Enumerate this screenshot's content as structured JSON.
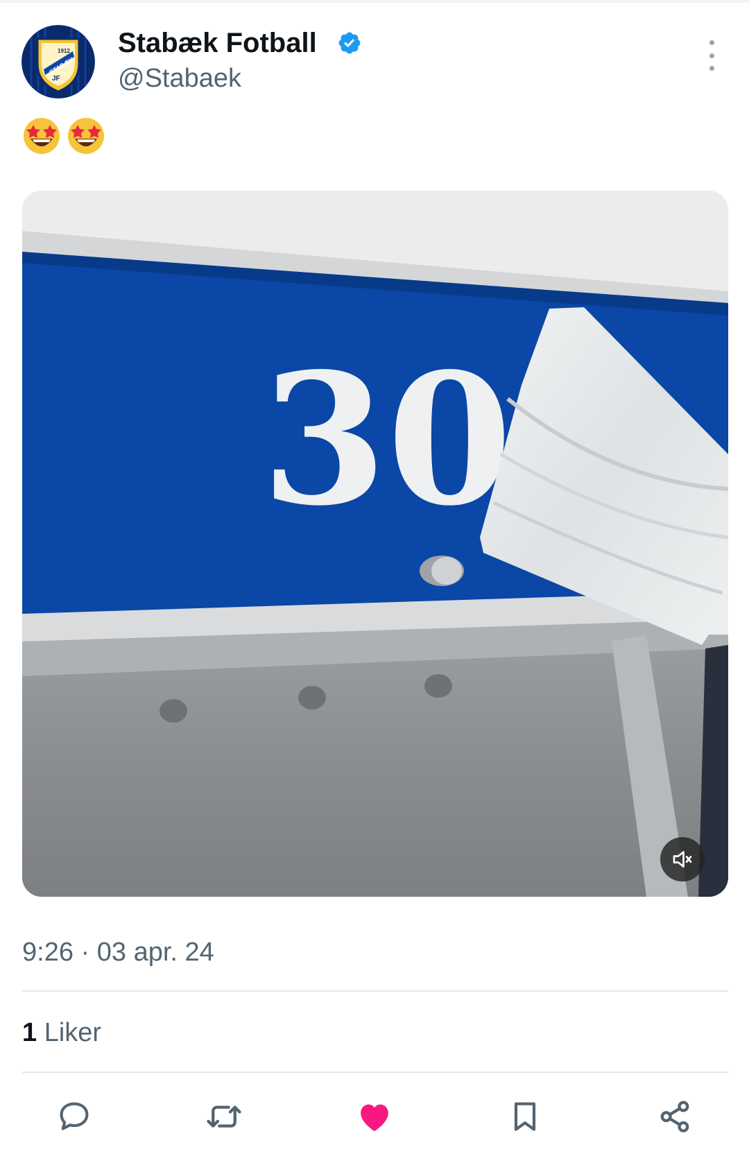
{
  "author": {
    "name": "Stabæk Fotball",
    "handle": "@Stabaek",
    "verified": true,
    "avatar_icon": "stabaek-club-crest",
    "avatar_text": "STABÆK",
    "avatar_year": "1912",
    "avatar_initials": "JF"
  },
  "tweet": {
    "text_emojis": [
      "star-struck-emoji",
      "star-struck-emoji"
    ],
    "media": {
      "type": "video",
      "description_number": "30",
      "mute_icon": "muted-speaker-icon"
    },
    "timestamp": {
      "time": "9:26",
      "separator": "·",
      "date": "03 apr. 24"
    }
  },
  "stats": {
    "likes_count": "1",
    "likes_label": "Liker"
  },
  "actions": [
    {
      "name": "reply",
      "icon": "reply-icon"
    },
    {
      "name": "retweet",
      "icon": "retweet-icon"
    },
    {
      "name": "like",
      "icon": "heart-icon",
      "active": true
    },
    {
      "name": "bookmark",
      "icon": "bookmark-icon"
    },
    {
      "name": "share",
      "icon": "share-icon"
    }
  ],
  "colors": {
    "verified": "#1d9bf0",
    "like_active": "#f91880",
    "secondary_text": "#536471",
    "primary_text": "#0f1419",
    "locker_blue": "#0a47a6"
  }
}
